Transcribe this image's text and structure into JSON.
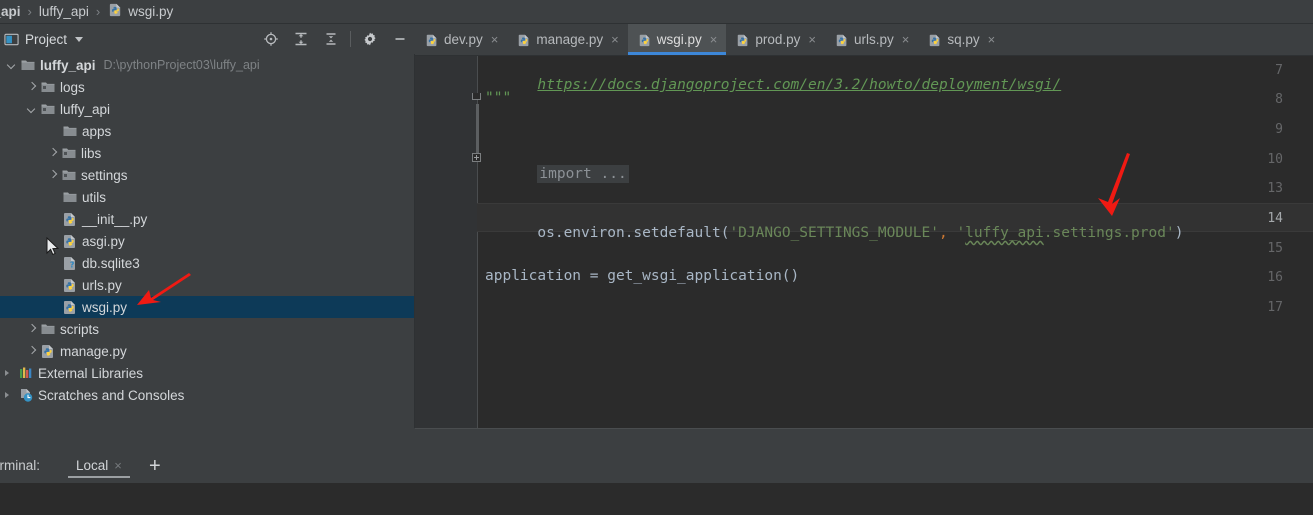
{
  "breadcrumb": {
    "items": [
      {
        "label": "y_api",
        "bold": true,
        "icon": "none"
      },
      {
        "label": "luffy_api",
        "bold": false,
        "icon": "none"
      },
      {
        "label": "wsgi.py",
        "bold": false,
        "icon": "python-file-icon"
      }
    ],
    "separator": "›"
  },
  "project_panel": {
    "title": "Project",
    "caret": "chevron-down-icon",
    "toolbar": [
      {
        "name": "locate-icon",
        "tooltip": "Select Opened File"
      },
      {
        "name": "expand-all-icon",
        "tooltip": "Expand All"
      },
      {
        "name": "collapse-all-icon",
        "tooltip": "Collapse All"
      },
      {
        "name": "settings-gear-icon",
        "tooltip": "Settings"
      },
      {
        "name": "minimize-icon",
        "tooltip": "Hide"
      }
    ]
  },
  "tree": {
    "rows": [
      {
        "label": "luffy_api",
        "path": "D:\\pythonProject03\\luffy_api",
        "icon": "folder-module-icon",
        "indent": 0,
        "arrow": "down",
        "bold": true,
        "selected": false
      },
      {
        "label": "logs",
        "path": "",
        "icon": "folder-source-icon",
        "indent": 1,
        "arrow": "right",
        "bold": false,
        "selected": false
      },
      {
        "label": "luffy_api",
        "path": "",
        "icon": "folder-source-icon",
        "indent": 1,
        "arrow": "down",
        "bold": false,
        "selected": false
      },
      {
        "label": "apps",
        "path": "",
        "icon": "folder-icon",
        "indent": 2,
        "arrow": "none",
        "bold": false,
        "selected": false
      },
      {
        "label": "libs",
        "path": "",
        "icon": "folder-source-icon",
        "indent": 2,
        "arrow": "right",
        "bold": false,
        "selected": false
      },
      {
        "label": "settings",
        "path": "",
        "icon": "folder-source-icon",
        "indent": 2,
        "arrow": "right",
        "bold": false,
        "selected": false
      },
      {
        "label": "utils",
        "path": "",
        "icon": "folder-icon",
        "indent": 2,
        "arrow": "none",
        "bold": false,
        "selected": false
      },
      {
        "label": "__init__.py",
        "path": "",
        "icon": "python-file-icon",
        "indent": 3,
        "arrow": "none",
        "bold": false,
        "selected": false
      },
      {
        "label": "asgi.py",
        "path": "",
        "icon": "python-file-icon",
        "indent": 3,
        "arrow": "none",
        "bold": false,
        "selected": false
      },
      {
        "label": "db.sqlite3",
        "path": "",
        "icon": "unknown-file-icon",
        "indent": 3,
        "arrow": "none",
        "bold": false,
        "selected": false
      },
      {
        "label": "urls.py",
        "path": "",
        "icon": "python-file-icon",
        "indent": 3,
        "arrow": "none",
        "bold": false,
        "selected": false
      },
      {
        "label": "wsgi.py",
        "path": "",
        "icon": "python-file-icon",
        "indent": 3,
        "arrow": "none",
        "bold": false,
        "selected": true
      },
      {
        "label": "scripts",
        "path": "",
        "icon": "folder-icon",
        "indent": 1,
        "arrow": "right",
        "bold": false,
        "selected": false
      },
      {
        "label": "manage.py",
        "path": "",
        "icon": "python-file-icon",
        "indent": 1,
        "arrow": "right",
        "bold": false,
        "selected": false
      },
      {
        "label": "External Libraries",
        "path": "",
        "icon": "libraries-icon",
        "indent": 0,
        "arrow": "tiny-right",
        "bold": false,
        "selected": false
      },
      {
        "label": "Scratches and Consoles",
        "path": "",
        "icon": "scratches-icon",
        "indent": 0,
        "arrow": "tiny-right",
        "bold": false,
        "selected": false
      }
    ]
  },
  "tabs": [
    {
      "label": "dev.py",
      "active": false,
      "icon": "python-file-icon",
      "close": "×"
    },
    {
      "label": "manage.py",
      "active": false,
      "icon": "python-file-icon",
      "close": "×"
    },
    {
      "label": "wsgi.py",
      "active": true,
      "icon": "python-file-icon",
      "close": "×"
    },
    {
      "label": "prod.py",
      "active": false,
      "icon": "python-file-icon",
      "close": "×"
    },
    {
      "label": "urls.py",
      "active": false,
      "icon": "python-file-icon",
      "close": "×"
    },
    {
      "label": "sq.py",
      "active": false,
      "icon": "python-file-icon",
      "close": "×"
    }
  ],
  "editor": {
    "line_numbers": [
      "7",
      "8",
      "9",
      "10",
      "13",
      "14",
      "15",
      "16",
      "17"
    ],
    "current_line": "14",
    "code": {
      "l7_link": "https://docs.djangoproject.com/en/3.2/howto/deployment/wsgi/",
      "l8_quotes": "\"\"\"",
      "l10_fold": "import ...",
      "l14_a": "os.environ.setdefault(",
      "l14_str1": "'DJANGO_SETTINGS_MODULE'",
      "l14_comma": ",",
      "l14_q_open": "'",
      "l14_mod": "luffy_api",
      "l14_rest": ".settings.prod",
      "l14_q_close": "'",
      "l14_close": ")",
      "l16": "application = get_wsgi_application()"
    }
  },
  "status_bar": {
    "terminal_label": "erminal:",
    "tab_label": "Local",
    "tab_close": "×",
    "add_button": "+"
  },
  "annotations": {
    "arrow_color": "#f01a13",
    "arrow_tree_target": "wsgi.py tree item",
    "arrow_editor_target": "luffy_api.settings.prod string"
  },
  "colors": {
    "panel_bg": "#3c3f41",
    "editor_bg": "#2b2b2b",
    "gutter_bg": "#313335",
    "selection": "#0d3a58",
    "tab_active": "#4e5254",
    "tab_underline": "#3d87d8",
    "string_green": "#6a8759",
    "doc_green": "#629755",
    "code_fg": "#a9b7c6"
  }
}
